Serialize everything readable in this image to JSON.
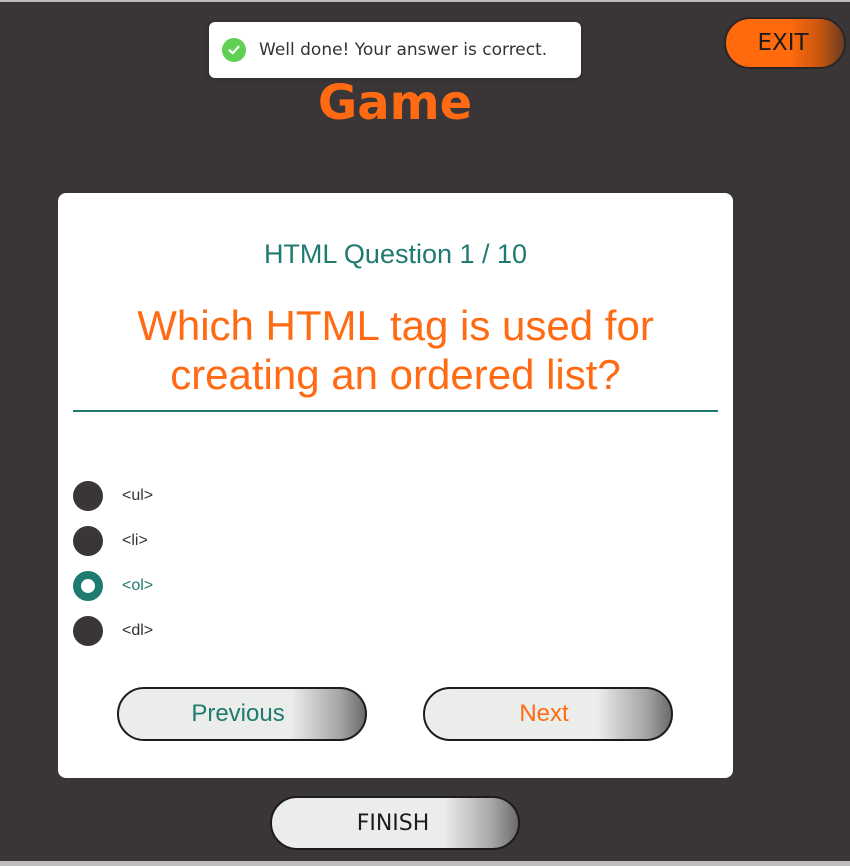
{
  "toast": {
    "message": "Well done! Your answer is correct.",
    "icon": "check-circle-icon",
    "color": "#5fd054"
  },
  "header": {
    "exit_label": "EXIT",
    "title": "Game"
  },
  "quiz": {
    "question_number": "HTML Question 1 / 10",
    "question": "Which HTML tag is used for creating an ordered list?",
    "options": [
      {
        "label": "<ul>",
        "selected": false
      },
      {
        "label": "<li>",
        "selected": false
      },
      {
        "label": "<ol>",
        "selected": true
      },
      {
        "label": "<dl>",
        "selected": false
      }
    ],
    "previous_label": "Previous",
    "next_label": "Next"
  },
  "footer": {
    "finish_label": "FINISH"
  },
  "colors": {
    "background": "#3a3536",
    "accent_orange": "#ff6a13",
    "accent_teal": "#1f7a6f"
  }
}
